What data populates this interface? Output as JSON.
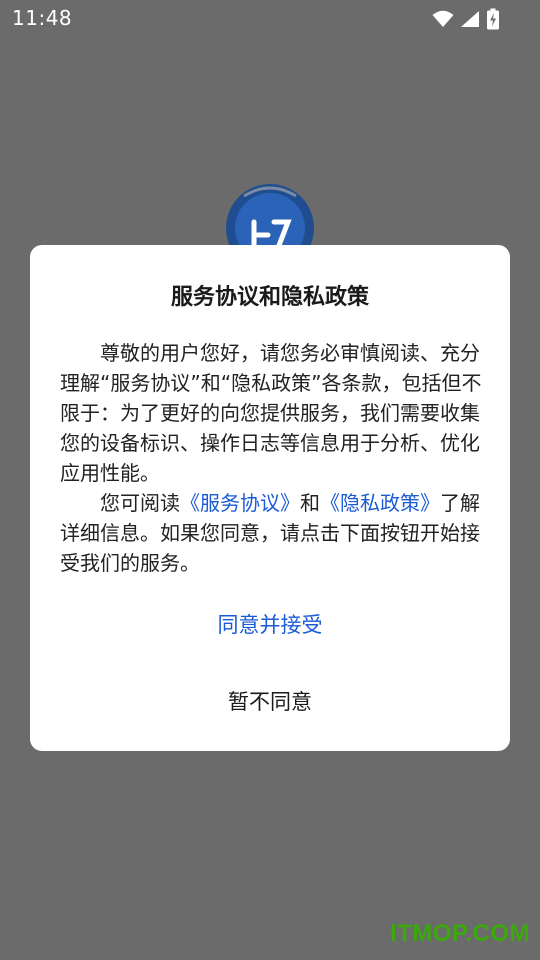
{
  "status_bar": {
    "time": "11:48",
    "icons": [
      "wifi-icon",
      "signal-icon",
      "battery-charging-icon"
    ]
  },
  "dialog": {
    "title": "服务协议和隐私政策",
    "paragraph1": "尊敬的用户您好，请您务必审慎阅读、充分理解“服务协议”和“隐私政策”各条款，包括但不限于：为了更好的向您提供服务，我们需要收集您的设备标识、操作日志等信息用于分析、优化应用性能。",
    "paragraph2_prefix": "您可阅读",
    "link_service": "《服务协议》",
    "paragraph2_and": "和",
    "link_privacy": "《隐私政策》",
    "paragraph2_suffix": "了解详细信息。如果您同意，请点击下面按钮开始接受我们的服务。",
    "agree_button": "同意并接受",
    "disagree_button": "暂不同意"
  },
  "watermark": "ITMOP.COM",
  "colors": {
    "overlay": "#6b6b6b",
    "link": "#1a5bd6",
    "watermark": "#3ba80c"
  }
}
